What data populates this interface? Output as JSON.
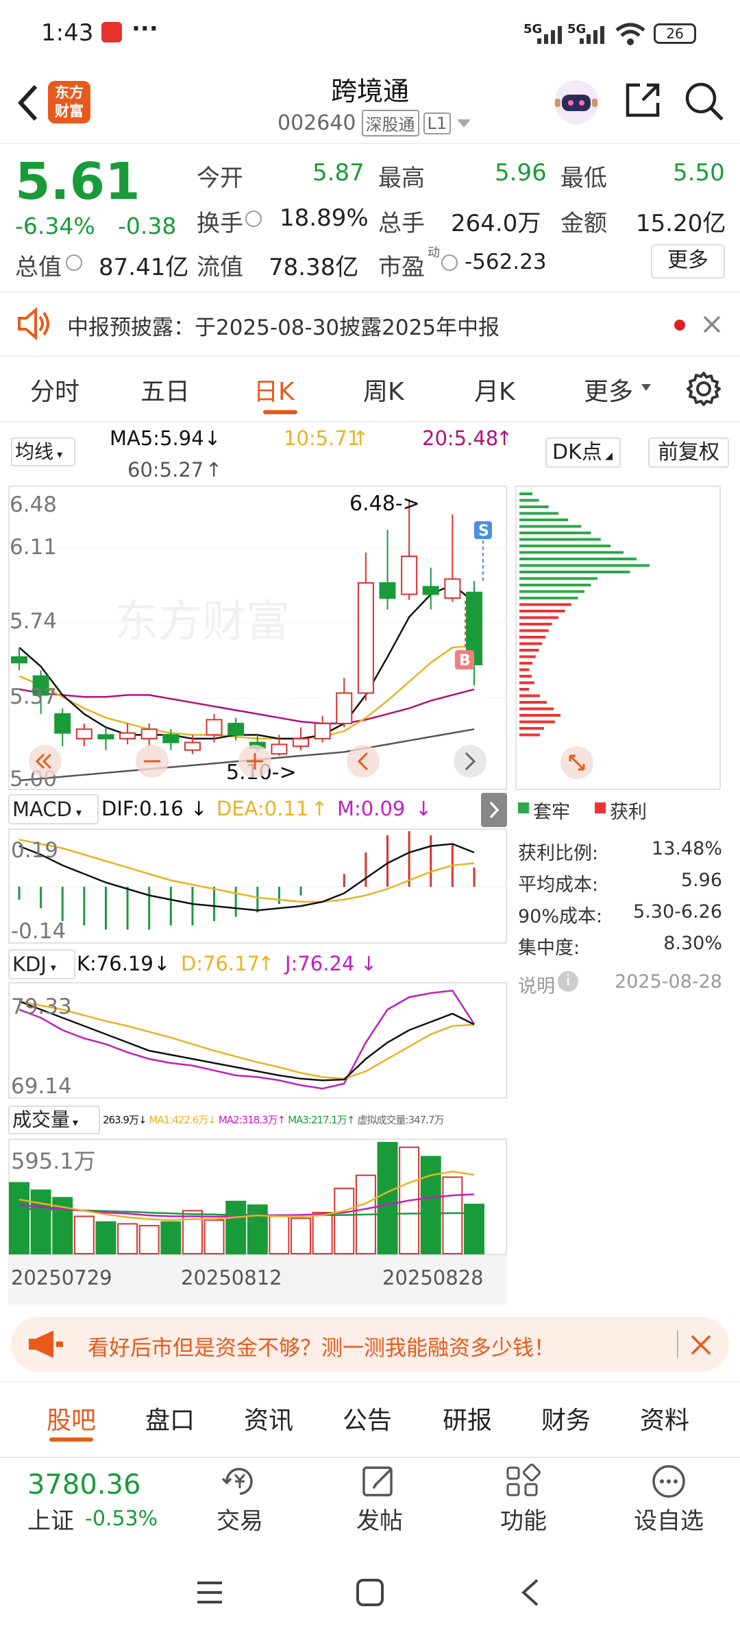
{
  "status": {
    "time": "1:43",
    "dots": "···",
    "battery": "26",
    "net1": "5G",
    "net2": "5G"
  },
  "header": {
    "title": "跨境通",
    "code": "002640",
    "board": "深股通",
    "level": "L1",
    "logo": "东方财富"
  },
  "quote": {
    "price": "5.61",
    "pct": "-6.34%",
    "chg": "-0.38",
    "open_l": "今开",
    "open": "5.87",
    "high_l": "最高",
    "high": "5.96",
    "low_l": "最低",
    "low": "5.50",
    "turnover_l": "换手",
    "turnover": "18.89%",
    "vol_l": "总手",
    "vol": "264.0万",
    "amt_l": "金额",
    "amt": "15.20亿",
    "mcap_l": "总值",
    "mcap": "87.41亿",
    "float_l": "流值",
    "float": "78.38亿",
    "pe_l": "市盈",
    "pe_sup": "动",
    "pe": "-562.23",
    "more": "更多"
  },
  "notice": {
    "text": "中报预披露：于2025-08-30披露2025年中报"
  },
  "tabs": [
    "分时",
    "五日",
    "日K",
    "周K",
    "月K",
    "更多"
  ],
  "ma_bar": {
    "sel": "均线",
    "ma5": "MA5:5.94",
    "ma10": "10:5.71",
    "ma20": "20:5.48",
    "ma60": "60:5.27",
    "dk": "DK点",
    "adj": "前复权"
  },
  "kline": {
    "y_labels": [
      "6.48",
      "6.11",
      "5.74",
      "5.37",
      "5.00"
    ],
    "high_mark": "6.48->",
    "low_mark": "5.10->",
    "sell": "S",
    "buy": "B",
    "watermark": "东方财富"
  },
  "chart_data": {
    "type": "candlestick",
    "dates_shown": [
      "20250729",
      "20250812",
      "20250828"
    ],
    "candles": [
      [
        5.65,
        5.62,
        5.7,
        5.58
      ],
      [
        5.55,
        5.45,
        5.58,
        5.35
      ],
      [
        5.35,
        5.25,
        5.38,
        5.18
      ],
      [
        5.22,
        5.27,
        5.3,
        5.18
      ],
      [
        5.24,
        5.22,
        5.28,
        5.16
      ],
      [
        5.22,
        5.25,
        5.3,
        5.19
      ],
      [
        5.22,
        5.27,
        5.3,
        5.18
      ],
      [
        5.24,
        5.2,
        5.27,
        5.16
      ],
      [
        5.16,
        5.2,
        5.24,
        5.14
      ],
      [
        5.24,
        5.32,
        5.35,
        5.2
      ],
      [
        5.3,
        5.24,
        5.33,
        5.21
      ],
      [
        5.2,
        5.17,
        5.24,
        5.15
      ],
      [
        5.14,
        5.19,
        5.24,
        5.13
      ],
      [
        5.18,
        5.22,
        5.28,
        5.16
      ],
      [
        5.22,
        5.3,
        5.34,
        5.2
      ],
      [
        5.3,
        5.46,
        5.54,
        5.28
      ],
      [
        5.46,
        6.04,
        6.2,
        5.42
      ],
      [
        6.04,
        5.96,
        6.32,
        5.9
      ],
      [
        5.98,
        6.18,
        6.48,
        5.95
      ],
      [
        6.02,
        5.98,
        6.12,
        5.9
      ],
      [
        5.96,
        6.06,
        6.4,
        5.94
      ],
      [
        5.99,
        5.61,
        6.05,
        5.5
      ]
    ],
    "ma5": [
      5.7,
      5.6,
      5.45,
      5.35,
      5.28,
      5.24,
      5.24,
      5.24,
      5.22,
      5.22,
      5.24,
      5.24,
      5.22,
      5.22,
      5.24,
      5.3,
      5.45,
      5.65,
      5.86,
      5.98,
      6.03,
      5.94
    ],
    "ma10": [
      5.55,
      5.5,
      5.44,
      5.38,
      5.33,
      5.3,
      5.27,
      5.25,
      5.24,
      5.24,
      5.23,
      5.22,
      5.22,
      5.22,
      5.23,
      5.26,
      5.33,
      5.42,
      5.52,
      5.62,
      5.7,
      5.71
    ],
    "ma20": [
      5.48,
      5.46,
      5.45,
      5.44,
      5.44,
      5.45,
      5.45,
      5.43,
      5.41,
      5.39,
      5.37,
      5.35,
      5.33,
      5.31,
      5.3,
      5.3,
      5.32,
      5.35,
      5.38,
      5.42,
      5.45,
      5.48
    ],
    "ma60": [
      5.0,
      5.01,
      5.02,
      5.03,
      5.04,
      5.05,
      5.06,
      5.07,
      5.08,
      5.09,
      5.1,
      5.11,
      5.12,
      5.13,
      5.14,
      5.15,
      5.17,
      5.19,
      5.21,
      5.23,
      5.25,
      5.27
    ],
    "volume": [
      380,
      340,
      300,
      200,
      170,
      160,
      150,
      170,
      230,
      180,
      280,
      260,
      200,
      190,
      220,
      350,
      420,
      595,
      570,
      520,
      410,
      264
    ],
    "vol_ma1": [
      290,
      270,
      250,
      230,
      210,
      195,
      185,
      180,
      185,
      185,
      195,
      205,
      200,
      200,
      205,
      230,
      270,
      330,
      380,
      420,
      440,
      422.6
    ],
    "vol_ma2": [
      260,
      250,
      240,
      230,
      220,
      215,
      205,
      200,
      200,
      198,
      200,
      205,
      205,
      208,
      212,
      220,
      240,
      262,
      285,
      300,
      312,
      318.3
    ],
    "vol_ma3": [
      240,
      238,
      235,
      232,
      228,
      225,
      220,
      216,
      212,
      210,
      208,
      207,
      206,
      206,
      206,
      207,
      210,
      213,
      215,
      216,
      217,
      217.1
    ],
    "macd_dif": [
      0.19,
      0.15,
      0.1,
      0.06,
      0.02,
      -0.01,
      -0.04,
      -0.06,
      -0.08,
      -0.09,
      -0.1,
      -0.11,
      -0.1,
      -0.09,
      -0.07,
      -0.03,
      0.04,
      0.11,
      0.16,
      0.19,
      0.2,
      0.16
    ],
    "macd_dea": [
      0.22,
      0.2,
      0.18,
      0.15,
      0.12,
      0.09,
      0.06,
      0.03,
      0.01,
      -0.01,
      -0.03,
      -0.05,
      -0.06,
      -0.07,
      -0.07,
      -0.06,
      -0.04,
      -0.01,
      0.03,
      0.07,
      0.1,
      0.11
    ],
    "macd_m": [
      -0.06,
      -0.1,
      -0.16,
      -0.18,
      -0.2,
      -0.2,
      -0.2,
      -0.18,
      -0.18,
      -0.16,
      -0.14,
      -0.12,
      -0.08,
      -0.04,
      0.0,
      0.06,
      0.16,
      0.24,
      0.26,
      0.24,
      0.2,
      0.09
    ],
    "kdj_k": [
      79,
      78,
      77,
      76,
      75,
      74,
      73,
      72.5,
      72,
      71.5,
      71,
      70.5,
      70,
      69.6,
      69.4,
      69.5,
      72,
      74,
      75.5,
      76.5,
      77.5,
      76.19
    ],
    "kdj_d": [
      79,
      78.5,
      78,
      77.3,
      76.6,
      76,
      75.3,
      74.6,
      73.8,
      73,
      72.3,
      71.6,
      71,
      70.3,
      69.8,
      69.6,
      70.5,
      72,
      73.5,
      75,
      76,
      76.17
    ],
    "kdj_j": [
      78,
      77,
      75.5,
      74.5,
      73.8,
      72.8,
      72,
      71.5,
      71.2,
      70.6,
      70,
      69.8,
      69.4,
      68.8,
      68.4,
      69,
      74,
      78,
      79.5,
      80,
      80.3,
      76.24
    ]
  },
  "macd_bar": {
    "sel": "MACD",
    "dif": "DIF:0.16",
    "dea": "DEA:0.11",
    "m": "M:0.09",
    "y1": "0.19",
    "y2": "-0.14"
  },
  "kdj_bar": {
    "sel": "KDJ",
    "k": "K:76.19",
    "d": "D:76.17",
    "j": "J:76.24",
    "y1": "79.33",
    "y2": "69.14"
  },
  "vol_bar": {
    "sel": "成交量",
    "v": "263.9万",
    "ma1": "MA1:422.6万",
    "ma2": "MA2:318.3万",
    "ma3": "MA3:217.1万",
    "virt": "虚拟成交量:347.7万",
    "y1": "595.1万"
  },
  "chips": {
    "legend_trap": "套牢",
    "legend_profit": "获利",
    "rows": [
      [
        "获利比例:",
        "13.48%"
      ],
      [
        "平均成本:",
        "5.96"
      ],
      [
        "90%成本:",
        "5.30-6.26"
      ],
      [
        "集中度:",
        "8.30%"
      ]
    ],
    "note": "说明",
    "date": "2025-08-28"
  },
  "ad": {
    "text": "看好后市但是资金不够？测一测我能融资多少钱！"
  },
  "bottom_tabs": [
    "股吧",
    "盘口",
    "资讯",
    "公告",
    "研报",
    "财务",
    "资料"
  ],
  "index": {
    "value": "3780.36",
    "name": "上证",
    "pct": "-0.53%"
  },
  "nav": [
    {
      "label": "交易",
      "icon": "trade-icon"
    },
    {
      "label": "发帖",
      "icon": "post-icon"
    },
    {
      "label": "功能",
      "icon": "apps-icon"
    },
    {
      "label": "设自选",
      "icon": "more-icon"
    }
  ],
  "colors": {
    "up": "#d8322c",
    "down": "#1a9b3a",
    "ma5": "#111111",
    "ma10": "#e6b422",
    "ma20": "#b0107a",
    "ma60": "#555555",
    "accent": "#e85a1b"
  }
}
